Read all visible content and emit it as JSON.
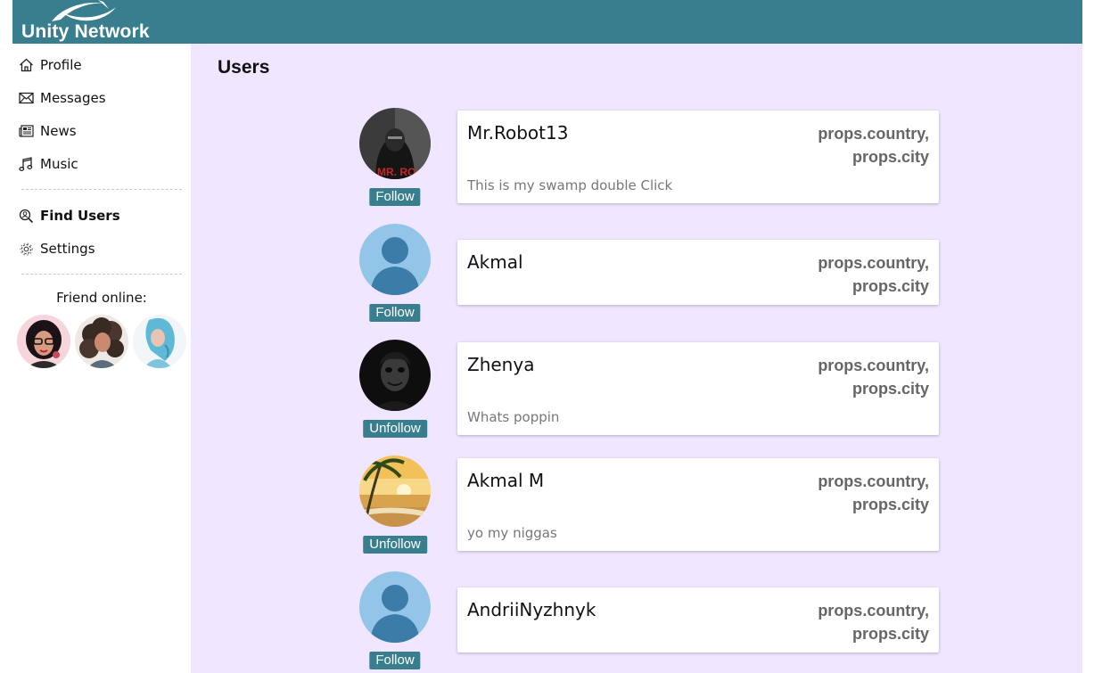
{
  "app": {
    "name": "Unity Network",
    "colors": {
      "brand": "#387e8e",
      "main_bg": "#f0e6ff",
      "text": "#111111",
      "muted": "#777777"
    }
  },
  "sidebar": {
    "items": [
      {
        "label": "Profile",
        "icon": "home-icon"
      },
      {
        "label": "Messages",
        "icon": "envelope-icon"
      },
      {
        "label": "News",
        "icon": "newspaper-icon"
      },
      {
        "label": "Music",
        "icon": "music-note-icon"
      },
      {
        "label": "Find Users",
        "icon": "search-user-icon",
        "active": true
      },
      {
        "label": "Settings",
        "icon": "gear-icon"
      }
    ],
    "friends_title": "Friend online:",
    "friends": [
      {
        "avatar": "friend-avatar-glasses"
      },
      {
        "avatar": "friend-avatar-curly-hair"
      },
      {
        "avatar": "friend-avatar-blue-hair"
      }
    ]
  },
  "main": {
    "title": "Users",
    "users": [
      {
        "name": "Mr.Robot13",
        "country": "props.country,",
        "city": "props.city",
        "status": "This is my swamp double Click",
        "button": "Follow",
        "avatar": "mr-robot-avatar"
      },
      {
        "name": "Akmal",
        "country": "props.country,",
        "city": "props.city",
        "status": "",
        "button": "Follow",
        "avatar": "default-avatar"
      },
      {
        "name": "Zhenya",
        "country": "props.country,",
        "city": "props.city",
        "status": "Whats poppin",
        "button": "Unfollow",
        "avatar": "joker-avatar"
      },
      {
        "name": "Akmal M",
        "country": "props.country,",
        "city": "props.city",
        "status": "yo my niggas",
        "button": "Unfollow",
        "avatar": "beach-sunset-avatar"
      },
      {
        "name": "AndriiNyzhnyk",
        "country": "props.country,",
        "city": "props.city",
        "status": "",
        "button": "Follow",
        "avatar": "default-avatar"
      }
    ]
  }
}
